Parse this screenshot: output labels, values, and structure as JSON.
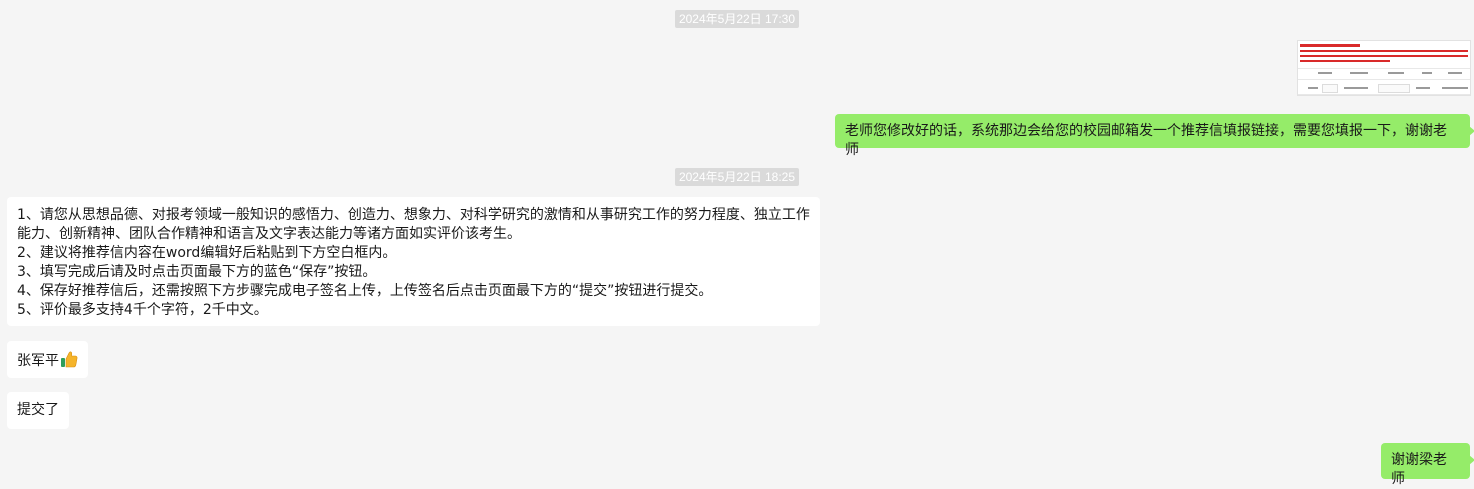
{
  "messages": {
    "ts1": "2024年5月22日 17:30",
    "msg_out_1": "老师您修改好的话，系统那边会给您的校园邮箱发一个推荐信填报链接，需要您填报一下，谢谢老师",
    "ts2": "2024年5月22日 18:25",
    "msg_in_1": {
      "line1": "1、请您从思想品德、对报考领域一般知识的感悟力、创造力、想象力、对科学研究的激情和从事研究工作的努力程度、独立工作",
      "line2": "能力、创新精神、团队合作精神和语言及文字表达能力等诸方面如实评价该考生。",
      "line3": "2、建议将推荐信内容在word编辑好后粘贴到下方空白框内。",
      "line4": "3、填写完成后请及时点击页面最下方的蓝色“保存”按钮。",
      "line5": "4、保存好推荐信后，还需按照下方步骤完成电子签名上传，上传签名后点击页面最下方的“提交”按钮进行提交。",
      "line6": "5、评价最多支持4千个字符，2千中文。"
    },
    "msg_in_2": "张军平",
    "msg_in_2_emoji": "thumbs-up-emoji",
    "msg_in_3": "提交了",
    "msg_out_2": "谢谢梁老师"
  },
  "colors": {
    "background": "#f5f5f5",
    "outgoing_bubble": "#95ec69",
    "incoming_bubble": "#ffffff",
    "timestamp_bg": "#dadada"
  }
}
